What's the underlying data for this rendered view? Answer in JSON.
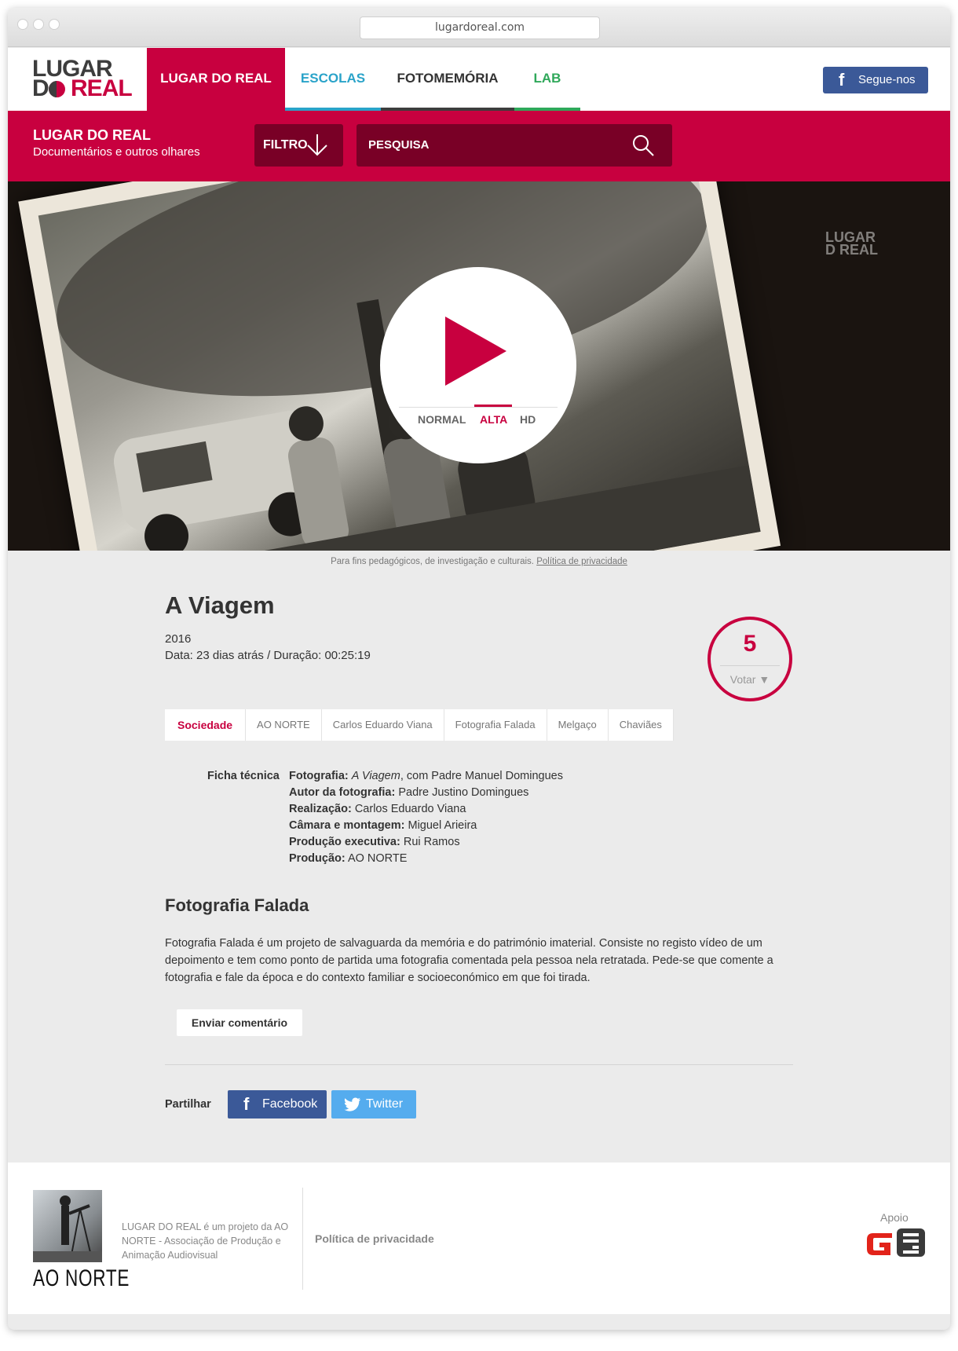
{
  "browser": {
    "url": "lugardoreal.com"
  },
  "header": {
    "logo_line1": "LUGAR",
    "logo_do": "D",
    "logo_real": "REAL",
    "nav": [
      {
        "label": "LUGAR DO REAL",
        "color": "#ffffff",
        "underline": "#c8003f"
      },
      {
        "label": "ESCOLAS",
        "color": "#2aa3c9",
        "underline": "#2aa3c9"
      },
      {
        "label": "FOTOMEMÓRIA",
        "color": "#333333",
        "underline": "#3d3d3d"
      },
      {
        "label": "LAB",
        "color": "#2fa85a",
        "underline": "#2fa85a"
      }
    ],
    "follow_label": "Segue-nos",
    "follow_icon": "facebook-icon"
  },
  "subheader": {
    "title": "LUGAR DO REAL",
    "subtitle": "Documentários e outros olhares",
    "filter_label": "FILTRO",
    "search_placeholder": "PESQUISA"
  },
  "player": {
    "watermark_line1": "LUGAR",
    "watermark_line2": "D REAL",
    "qualities": [
      "NORMAL",
      "ALTA",
      "HD"
    ],
    "selected_quality": "ALTA",
    "caption": "Para fins pedagógicos, de investigação e culturais.",
    "caption_link": "Política de privacidade"
  },
  "film": {
    "title": "A Viagem",
    "year": "2016",
    "meta": "Data: 23 dias atrás / Duração: 00:25:19",
    "votes": "5",
    "vote_label": "Votar ▼",
    "tags": [
      "Sociedade",
      "AO NORTE",
      "Carlos Eduardo Viana",
      "Fotografia Falada",
      "Melgaço",
      "Chaviães"
    ],
    "active_tag": "Sociedade",
    "ficha_label": "Ficha técnica",
    "ficha": [
      {
        "key": "Fotografia:",
        "value_italic": "A Viagem",
        "value": ", com Padre Manuel Domingues"
      },
      {
        "key": "Autor da fotografia:",
        "value": "Padre Justino Domingues"
      },
      {
        "key": "Realização:",
        "value": "Carlos Eduardo Viana"
      },
      {
        "key": "Câmara e montagem:",
        "value": "Miguel Arieira"
      },
      {
        "key": "Produção executiva:",
        "value": "Rui Ramos"
      },
      {
        "key": "Produção:",
        "value": "AO NORTE"
      }
    ],
    "section_title": "Fotografia Falada",
    "description": "Fotografia Falada é um projeto de salvaguarda da memória e do património imaterial. Consiste no registo vídeo de um depoimento e tem como ponto de partida uma fotografia comentada pela pessoa nela retratada. Pede-se que comente a fotografia e fale da época e do contexto familiar e socioeconómico em que foi tirada.",
    "comment_button": "Enviar comentário",
    "share_label": "Partilhar",
    "share": [
      {
        "label": "Facebook",
        "color": "#3b5998"
      },
      {
        "label": "Twitter",
        "color": "#55acee"
      }
    ]
  },
  "footer": {
    "org_logo_text": "AO NORTE",
    "description": "LUGAR DO REAL é um projeto da AO NORTE - Associação de Produção e Animação Audiovisual",
    "privacy": "Política de privacidade",
    "apoio": "Apoio",
    "sponsor_logo": "G9"
  },
  "colors": {
    "brand_red": "#c8003f",
    "dark_red": "#790026",
    "page_bg": "#ebebeb"
  }
}
